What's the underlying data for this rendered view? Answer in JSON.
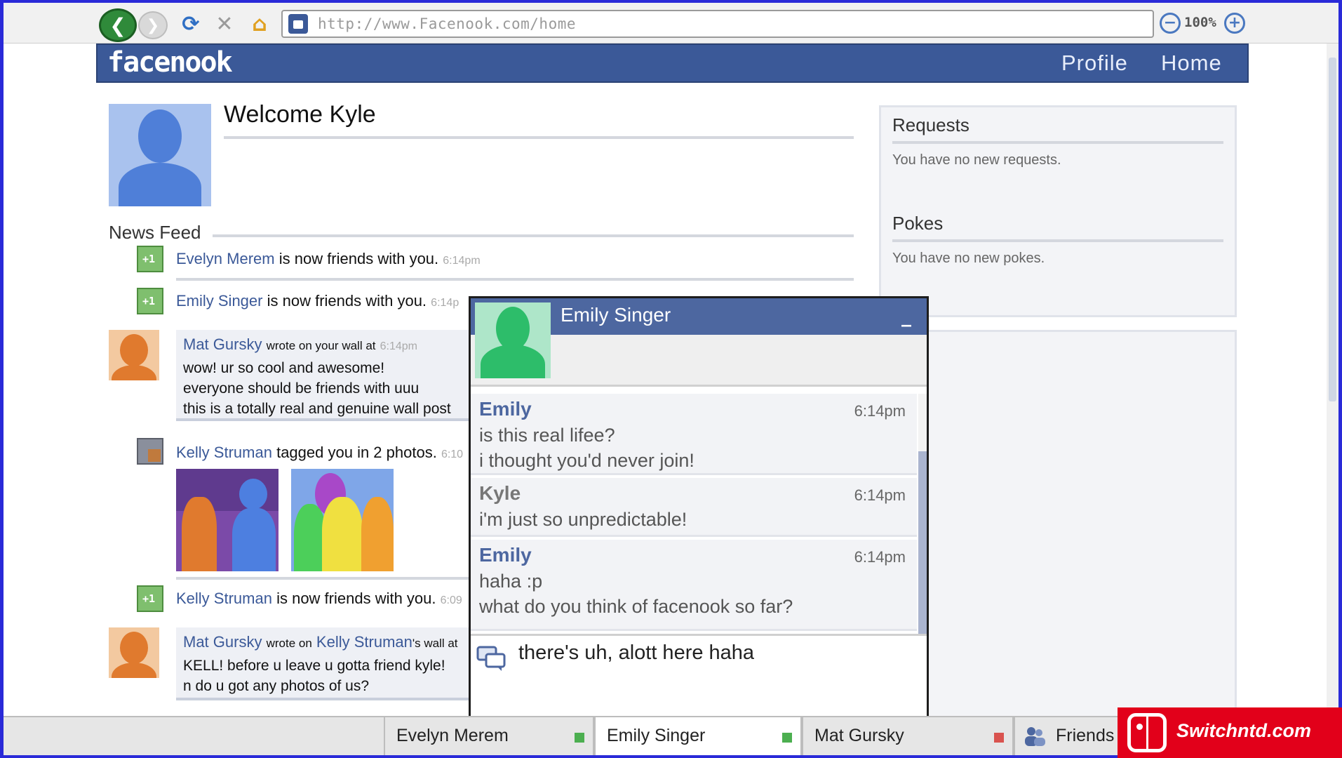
{
  "browser": {
    "url": "http://www.Facenook.com/home",
    "zoom": "100%"
  },
  "site": {
    "logo": "facenook",
    "nav": {
      "profile": "Profile",
      "home": "Home"
    }
  },
  "welcome": "Welcome Kyle",
  "news_feed": {
    "title": "News Feed",
    "items": [
      {
        "name": "Evelyn Merem",
        "text": "is now friends with you.",
        "time": "6:14pm"
      },
      {
        "name": "Emily Singer",
        "text": "is now friends with you.",
        "time": "6:14p"
      },
      {
        "name": "Mat Gursky",
        "text": "wrote on your wall at",
        "time": "6:14pm",
        "lines": [
          "wow! ur so cool and awesome!",
          "everyone should be friends with uuu",
          "this is a totally real and genuine wall post"
        ]
      },
      {
        "name": "Kelly Struman",
        "text": "tagged you in 2 photos.",
        "time": "6:10"
      },
      {
        "name": "Kelly Struman",
        "text": "is now friends with you.",
        "time": "6:09"
      },
      {
        "name": "Mat Gursky",
        "text": "wrote on",
        "target": "Kelly Struman",
        "suffix": "'s wall at",
        "lines": [
          "KELL! before u leave u gotta friend kyle!",
          "n do u got any photos of us?"
        ]
      }
    ]
  },
  "side": {
    "requests_title": "Requests",
    "requests_text": "You have no new requests.",
    "pokes_title": "Pokes",
    "pokes_text": "You have no new pokes."
  },
  "chat": {
    "name": "Emily Singer",
    "minimize": "_",
    "messages": [
      {
        "sender": "Emily",
        "time": "6:14pm",
        "lines": [
          "is this real lifee?",
          "i thought you'd never join!"
        ]
      },
      {
        "sender": "Kyle",
        "time": "6:14pm",
        "lines": [
          "i'm just so unpredictable!"
        ]
      },
      {
        "sender": "Emily",
        "time": "6:14pm",
        "lines": [
          "haha :p",
          "what do you think of facenook so far?"
        ]
      }
    ],
    "input": "there's uh, alott here haha"
  },
  "chatbar": {
    "tabs": [
      {
        "name": "Evelyn Merem",
        "status_color": "#4caf50"
      },
      {
        "name": "Emily Singer",
        "status_color": "#4caf50"
      },
      {
        "name": "Mat Gursky",
        "status_color": "#d9534f"
      }
    ],
    "friends_label": "Friends"
  },
  "watermark": "Switchntd.com",
  "colors": {
    "brand": "#3b5998",
    "chat_header": "#4d67a0"
  }
}
